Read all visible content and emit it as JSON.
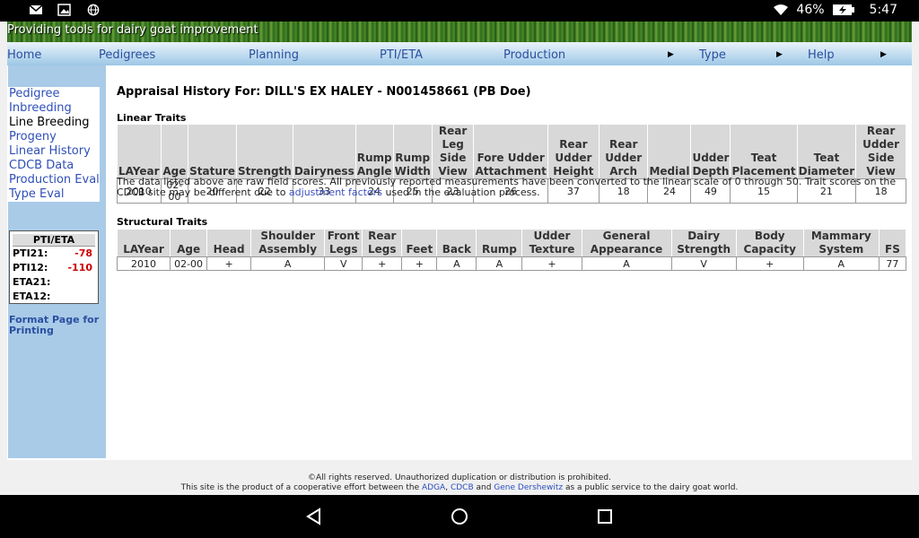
{
  "status": {
    "battery": "46%",
    "time": "5:47"
  },
  "banner": {
    "tagline": "Providing tools for dairy goat improvement"
  },
  "nav": {
    "home": "Home",
    "pedigrees": "Pedigrees",
    "planning": "Planning",
    "ptieta": "PTI/ETA",
    "production": "Production",
    "type": "Type",
    "help": "Help"
  },
  "sidebar": {
    "items": [
      "Pedigree",
      "Inbreeding",
      "Line Breeding",
      "Progeny",
      "Linear History",
      "CDCB Data",
      "Production Eval",
      "Type Eval"
    ],
    "pti": {
      "title": "PTI/ETA",
      "pti21_label": "PTI21:",
      "pti21": "-78",
      "pti12_label": "PTI12:",
      "pti12": "-110",
      "eta21_label": "ETA21:",
      "eta12_label": "ETA12:"
    },
    "format_link": "Format Page for Printing"
  },
  "main": {
    "title": "Appraisal History For: DILL'S EX HALEY - N001458661 (PB Doe)",
    "linear_label": "Linear Traits",
    "linear_headers": [
      "LAYear",
      "Age",
      "Stature",
      "Strength",
      "Dairyness",
      "Rump Angle",
      "Rump Width",
      "Rear Leg Side View",
      "Fore Udder Attachment",
      "Rear Udder Height",
      "Rear Udder Arch",
      "Medial",
      "Udder Depth",
      "Teat Placement",
      "Teat Diameter",
      "Rear Udder Side View"
    ],
    "linear_row": [
      "2010",
      "02-00",
      "20",
      "22",
      "33",
      "24",
      "25",
      "23",
      "26",
      "37",
      "18",
      "24",
      "49",
      "15",
      "21",
      "18"
    ],
    "note_before": "The data listed above are raw field scores. All previously reported measurements have been converted to the linear scale of 0 through 50. Trait scores on the CDCB site may be different due to ",
    "note_link": "adjustment factors",
    "note_after": " used in the evaluation process.",
    "structural_label": "Structural Traits",
    "structural_headers": [
      "LAYear",
      "Age",
      "Head",
      "Shoulder Assembly",
      "Front Legs",
      "Rear Legs",
      "Feet",
      "Back",
      "Rump",
      "Udder Texture",
      "General Appearance",
      "Dairy Strength",
      "Body Capacity",
      "Mammary System",
      "FS"
    ],
    "structural_row": [
      "2010",
      "02-00",
      "+",
      "A",
      "V",
      "+",
      "+",
      "A",
      "A",
      "+",
      "A",
      "V",
      "+",
      "A",
      "77"
    ]
  },
  "footer": {
    "line1": "©All rights reserved. Unauthorized duplication or distribution is prohibited.",
    "line2_a": "This site is the product of a cooperative effort between the ",
    "adga": "ADGA",
    "comma": ", ",
    "cdcb": "CDCB",
    "and": " and ",
    "gene": "Gene Dershewitz",
    "line2_b": " as a public service to the dairy goat world."
  }
}
